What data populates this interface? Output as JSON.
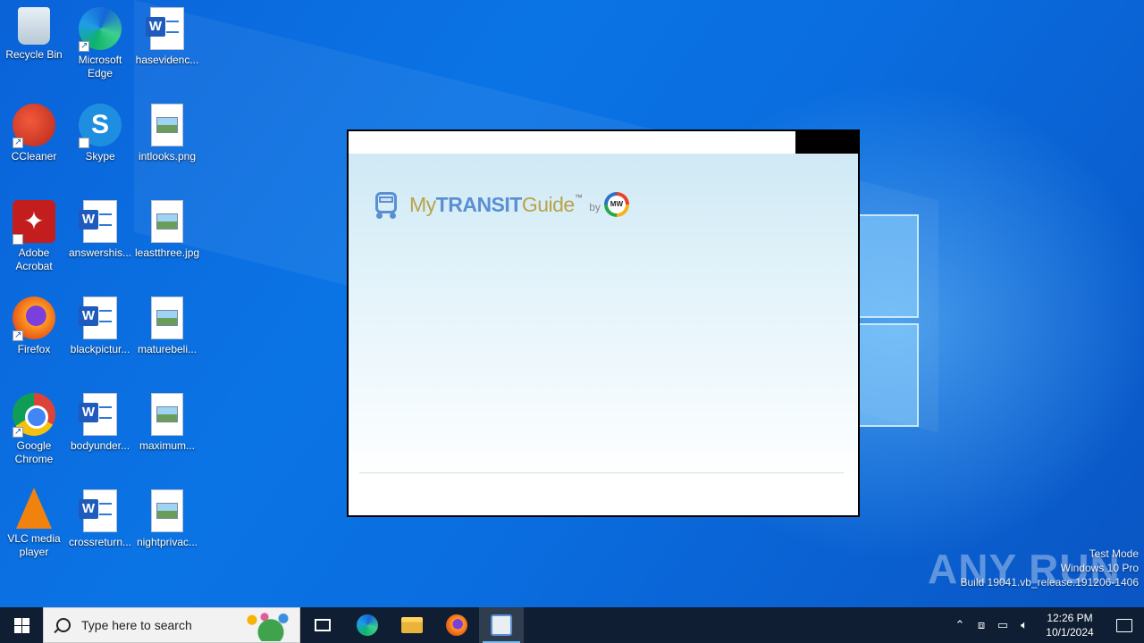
{
  "desktop": {
    "icons": [
      {
        "label": "Recycle Bin",
        "icon": "recycle-bin-icon"
      },
      {
        "label": "Microsoft Edge",
        "icon": "edge-icon"
      },
      {
        "label": "hasevidenc...",
        "icon": "word-document-icon"
      },
      {
        "label": "CCleaner",
        "icon": "ccleaner-icon"
      },
      {
        "label": "Skype",
        "icon": "skype-icon"
      },
      {
        "label": "intlooks.png",
        "icon": "image-file-icon"
      },
      {
        "label": "Adobe Acrobat",
        "icon": "acrobat-icon"
      },
      {
        "label": "answershis...",
        "icon": "word-document-icon"
      },
      {
        "label": "leastthree.jpg",
        "icon": "image-file-icon"
      },
      {
        "label": "Firefox",
        "icon": "firefox-icon"
      },
      {
        "label": "blackpictur...",
        "icon": "word-document-icon"
      },
      {
        "label": "maturebeli...",
        "icon": "image-file-icon"
      },
      {
        "label": "Google Chrome",
        "icon": "chrome-icon"
      },
      {
        "label": "bodyunder...",
        "icon": "word-document-icon"
      },
      {
        "label": "maximum...",
        "icon": "image-file-icon"
      },
      {
        "label": "VLC media player",
        "icon": "vlc-icon"
      },
      {
        "label": "crossreturn...",
        "icon": "word-document-icon"
      },
      {
        "label": "nightprivac...",
        "icon": "image-file-icon"
      }
    ]
  },
  "app_window": {
    "brand_my": "My",
    "brand_transit": "TRANSIT",
    "brand_guide": "Guide",
    "brand_tm": "™",
    "brand_by": "by",
    "badge_text": "MW",
    "colors": {
      "transit_blue": "#5a8fd3",
      "guide_gold": "#b8a44a"
    }
  },
  "watermark": {
    "logo": "ANY RUN",
    "line1": "Test Mode",
    "line2": "Windows 10 Pro",
    "line3": "Build 19041.vb_release.191206-1406"
  },
  "taskbar": {
    "search_placeholder": "Type here to search",
    "pinned": [
      "task-view-icon",
      "edge-icon",
      "file-explorer-icon",
      "firefox-icon",
      "mytransitguide-icon"
    ],
    "clock_time": "12:26 PM",
    "clock_date": "10/1/2024"
  }
}
